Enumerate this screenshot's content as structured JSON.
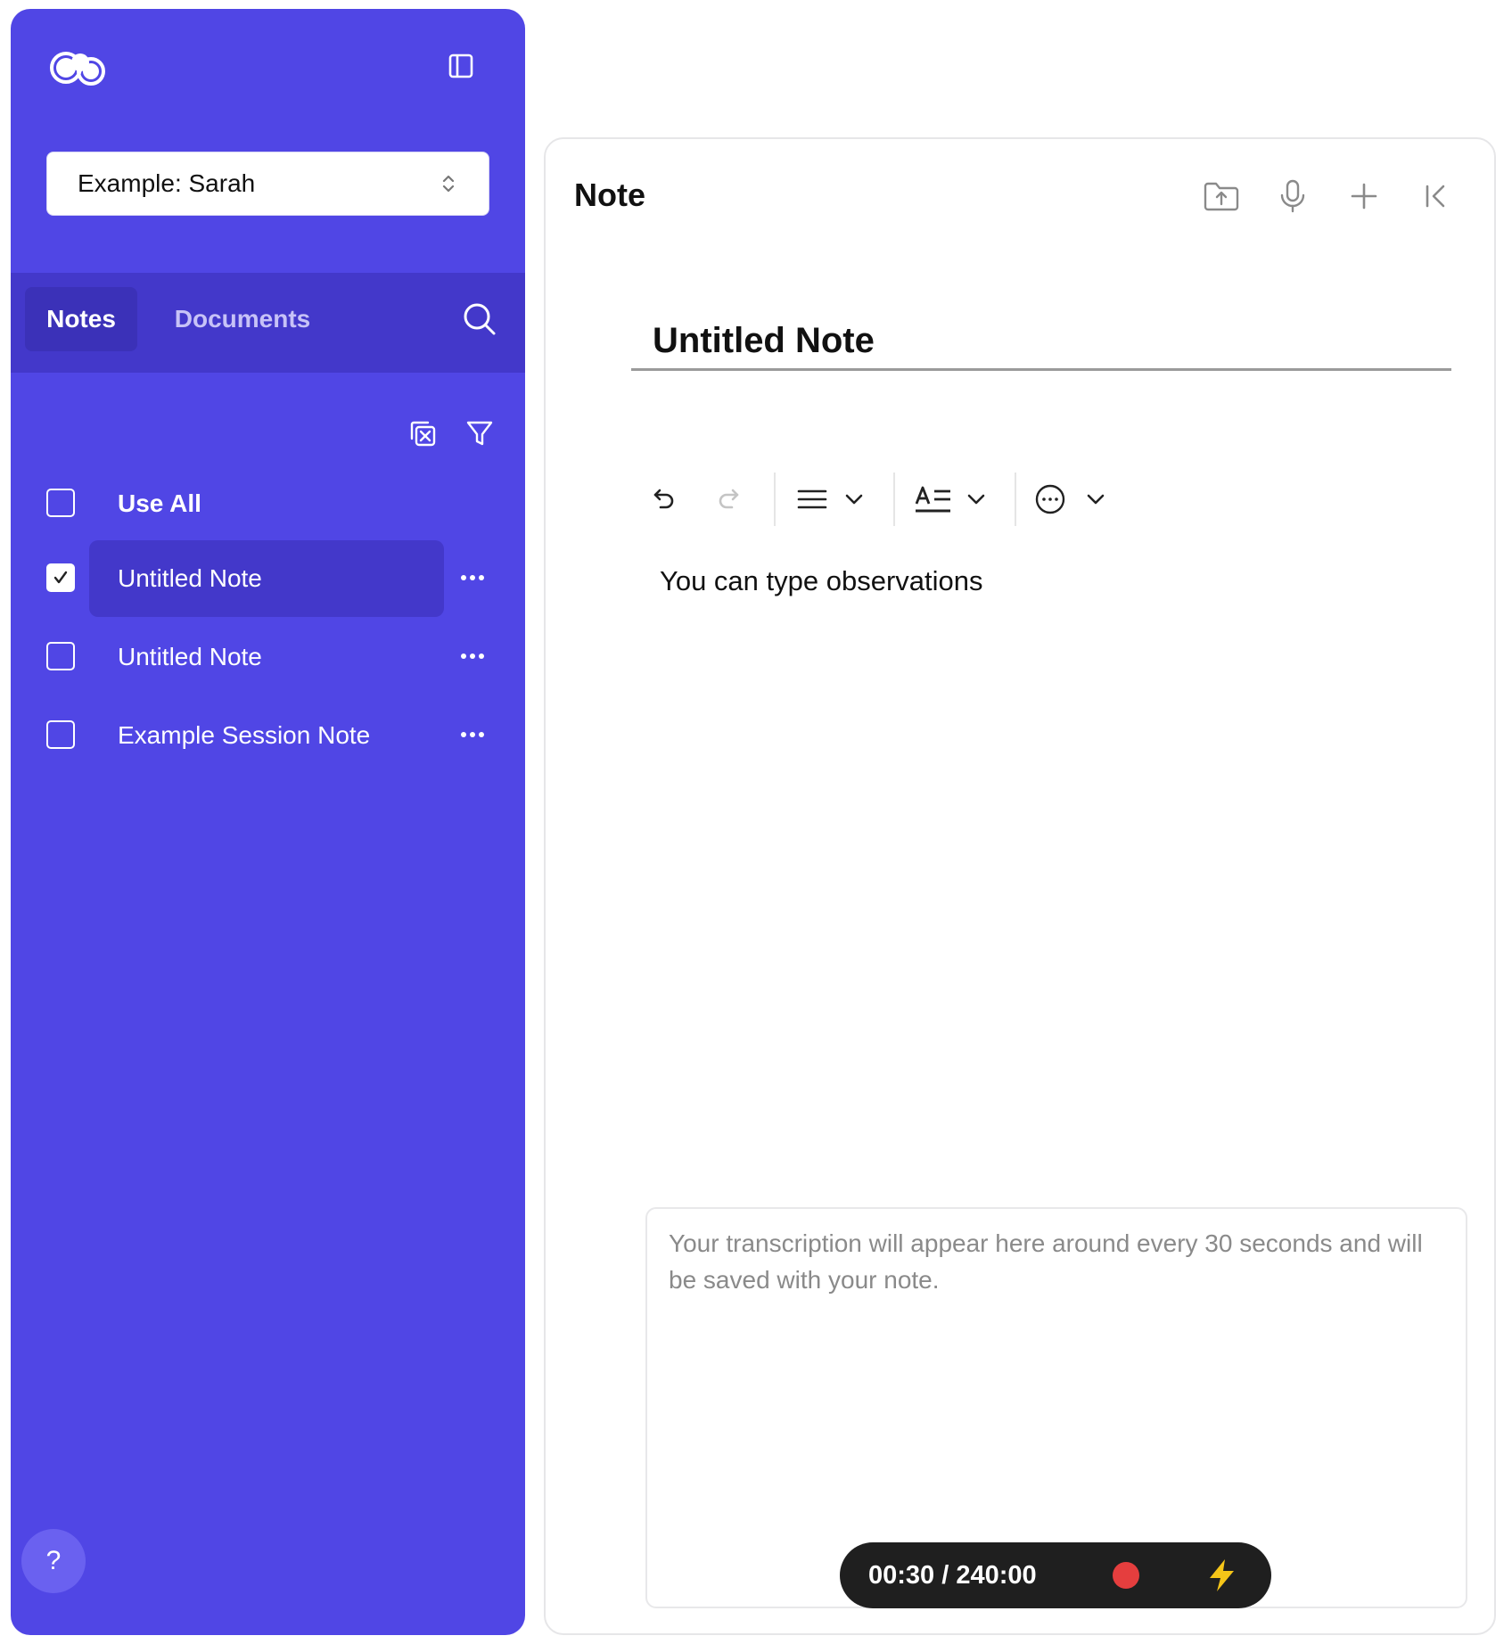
{
  "sidebar": {
    "client_select": {
      "value": "Example: Sarah"
    },
    "tabs": [
      {
        "label": "Notes",
        "active": true
      },
      {
        "label": "Documents",
        "active": false
      }
    ],
    "items": [
      {
        "label": "Use All",
        "checked": false
      },
      {
        "label": "Untitled Note",
        "checked": true
      },
      {
        "label": "Untitled Note",
        "checked": false
      },
      {
        "label": "Example Session Note",
        "checked": false
      }
    ],
    "help_label": "?",
    "accent_color": "#5046e5"
  },
  "note": {
    "panel_title": "Note",
    "title_value": "Untitled Note",
    "body_text": "You can type observations",
    "transcription_placeholder": "Your transcription will appear here around every 30 seconds and will be saved with your note.",
    "recorder": {
      "time": "00:30 / 240:00",
      "record_color": "#e53e3e",
      "bolt_color": "#f5c518"
    },
    "header_icons": [
      "folder-upload-icon",
      "microphone-icon",
      "plus-icon",
      "collapse-left-icon"
    ],
    "toolbar_icons": [
      "undo-icon",
      "redo-icon",
      "align-icon",
      "text-style-icon",
      "more-circle-icon"
    ]
  }
}
